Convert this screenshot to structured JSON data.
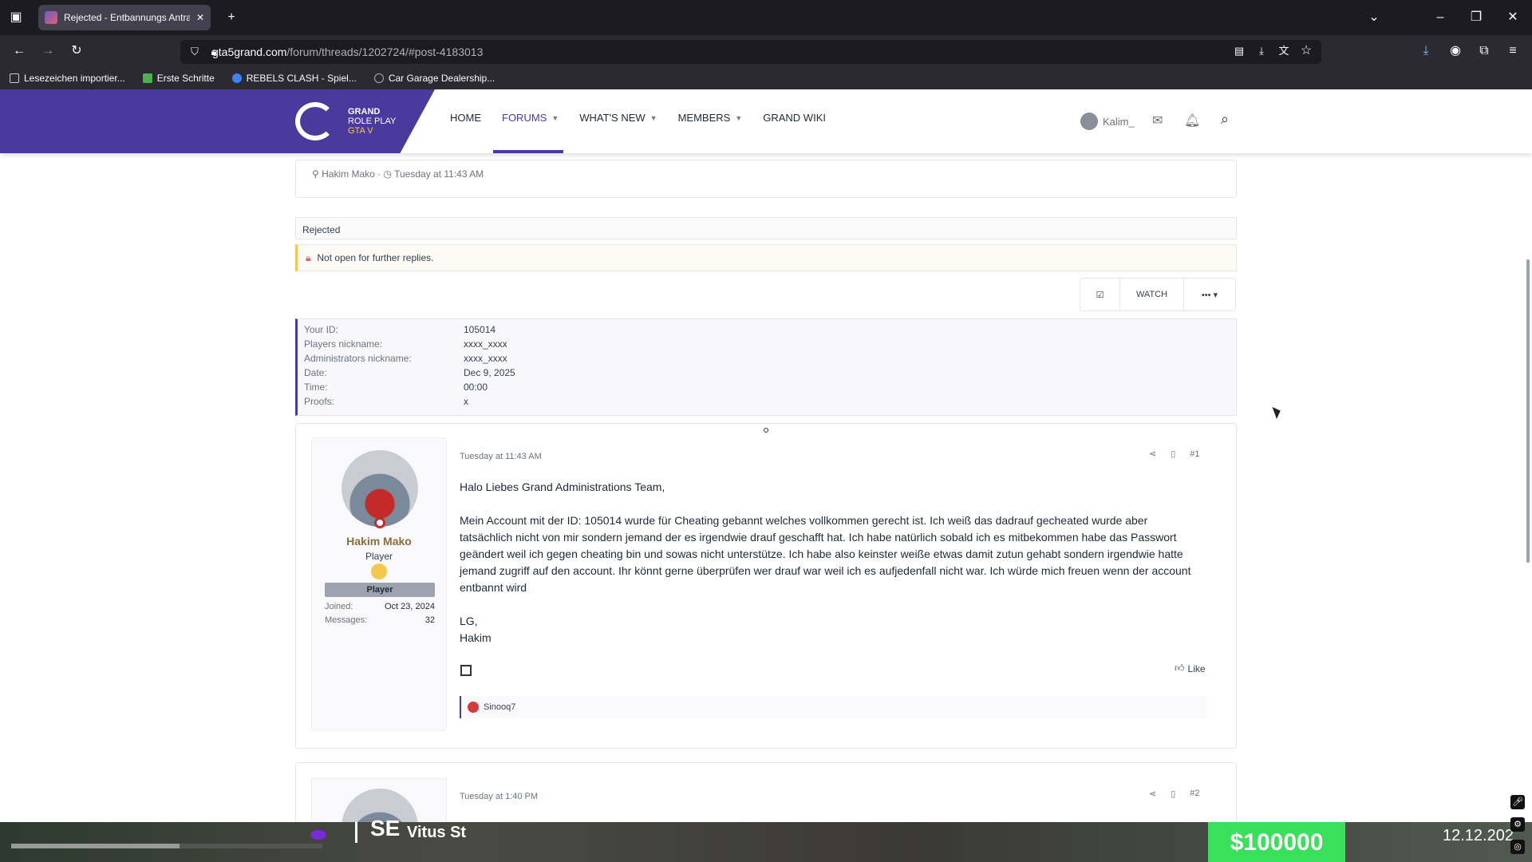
{
  "browser": {
    "tab_title": "Rejected - Entbannungs Antrag",
    "url_host": "gta5grand.com",
    "url_path": "/forum/threads/1202724/#post-4183013",
    "bookmarks": [
      {
        "label": "Lesezeichen importier...",
        "color": "#cccccc"
      },
      {
        "label": "Erste Schritte",
        "color": "#4caf50"
      },
      {
        "label": "REBELS CLASH - Spiel...",
        "color": "#3b82f6"
      },
      {
        "label": "Car Garage Dealership...",
        "color": "#aaaaaa"
      }
    ]
  },
  "site": {
    "logo_line1": "GRAND",
    "logo_line2": "ROLE PLAY",
    "logo_line3": "GTA V",
    "nav": [
      {
        "label": "HOME",
        "caret": false
      },
      {
        "label": "FORUMS",
        "caret": true
      },
      {
        "label": "WHAT'S NEW",
        "caret": true
      },
      {
        "label": "MEMBERS",
        "caret": true
      },
      {
        "label": "GRAND WIKI",
        "caret": false
      }
    ],
    "username": "Kalim_",
    "brand_color": "#4b3a9e"
  },
  "thread": {
    "author": "Hakim Mako",
    "time": "Tuesday at 11:43 AM",
    "prefix": "Rejected",
    "locked_notice": "Not open for further replies.",
    "watch_label": "WATCH",
    "fields": [
      {
        "key": "Your ID:",
        "value": "105014"
      },
      {
        "key": "Players nickname:",
        "value": "xxxx_xxxx"
      },
      {
        "key": "Administrators nickname:",
        "value": "xxxx_xxxx"
      },
      {
        "key": "Date:",
        "value": "Dec 9, 2025"
      },
      {
        "key": "Time:",
        "value": "00:00"
      },
      {
        "key": "Proofs:",
        "value": "x"
      }
    ]
  },
  "post1": {
    "username": "Hakim Mako",
    "user_title": "Player",
    "banner": "Player",
    "joined_label": "Joined:",
    "joined": "Oct 23, 2024",
    "messages_label": "Messages:",
    "messages": "32",
    "date": "Tuesday at 11:43 AM",
    "number": "#1",
    "greeting": "Halo Liebes Grand Administrations Team,",
    "body": "Mein Account mit der ID: 105014 wurde für Cheating gebannt welches vollkommen gerecht ist. Ich weiß das dadrauf gecheated wurde aber tatsächlich nicht von mir sondern jemand der es irgendwie drauf geschafft hat. Ich habe natürlich sobald ich es mitbekommen habe das Passwort geändert weil ich gegen cheating bin und sowas nicht unterstütze. Ich habe also keinster weiße etwas damit zutun gehabt sondern irgendwie hatte jemand zugriff auf den account. Ihr könnt gerne überprüfen wer drauf war weil ich es aufjedenfall nicht war. Ich würde mich freuen wenn der account entbannt wird",
    "signoff": "LG,\nHakim",
    "like_label": "Like",
    "reacted_by": "Sinooq7"
  },
  "post2": {
    "date": "Tuesday at 1:40 PM",
    "number": "#2"
  },
  "hud": {
    "compass": "SE",
    "street": "Vitus St",
    "money": "$100000",
    "date": "12.12.202",
    "money_color": "#39e05a"
  }
}
